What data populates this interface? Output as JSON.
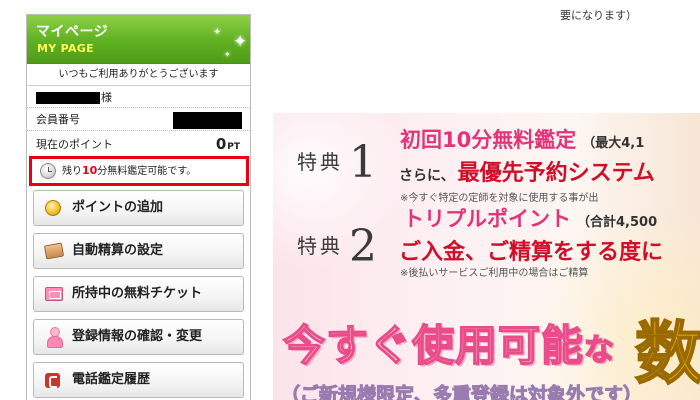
{
  "top_note": {
    "line1": "",
    "line2": "要になります）"
  },
  "sidebar": {
    "title": "マイページ",
    "subtitle": "MY PAGE",
    "greeting": "いつもご利用ありがとうございます",
    "name_suffix": "様",
    "member_label": "会員番号",
    "points_label": "現在のポイント",
    "points_value": "0",
    "points_unit": "PT",
    "free_prefix": "残り",
    "free_number": "10",
    "free_suffix": "分無料鑑定可能です。",
    "menu": [
      {
        "label": "ポイントの追加",
        "icon": "coin-icon"
      },
      {
        "label": "自動精算の設定",
        "icon": "wallet-icon"
      },
      {
        "label": "所持中の無料チケット",
        "icon": "ticket-icon"
      },
      {
        "label": "登録情報の確認・変更",
        "icon": "person-icon"
      },
      {
        "label": "電話鑑定履歴",
        "icon": "phone-icon"
      }
    ]
  },
  "banner": {
    "tokuten_label": "特典",
    "tokuten1_num": "1",
    "tokuten2_num": "2",
    "b1_heading": "初回10分無料鑑定",
    "b1_heading_note": "（最大4,1",
    "b1_sub_prefix": "さらに、",
    "b1_sub_main": "最優先予約システム",
    "b1_note": "※今すぐ特定の定師を対象に使用する事が出",
    "b2_heading": "トリプルポイント",
    "b2_heading_note": "（合計4,500",
    "b2_main": "ご入金、ご精算をする度に",
    "b2_note": "※後払いサービスご利用中の場合はご精算",
    "big_headline_main": "今すぐ使用可能",
    "big_headline_na": "な",
    "big_kanji": "数",
    "big_sub": "（ご新規様限定、多重登録は対象外です）"
  },
  "colors": {
    "header_green": "#5fb022",
    "highlight_red": "#e60012",
    "banner_pink": "#e5337a",
    "banner_red": "#d20d2a"
  }
}
